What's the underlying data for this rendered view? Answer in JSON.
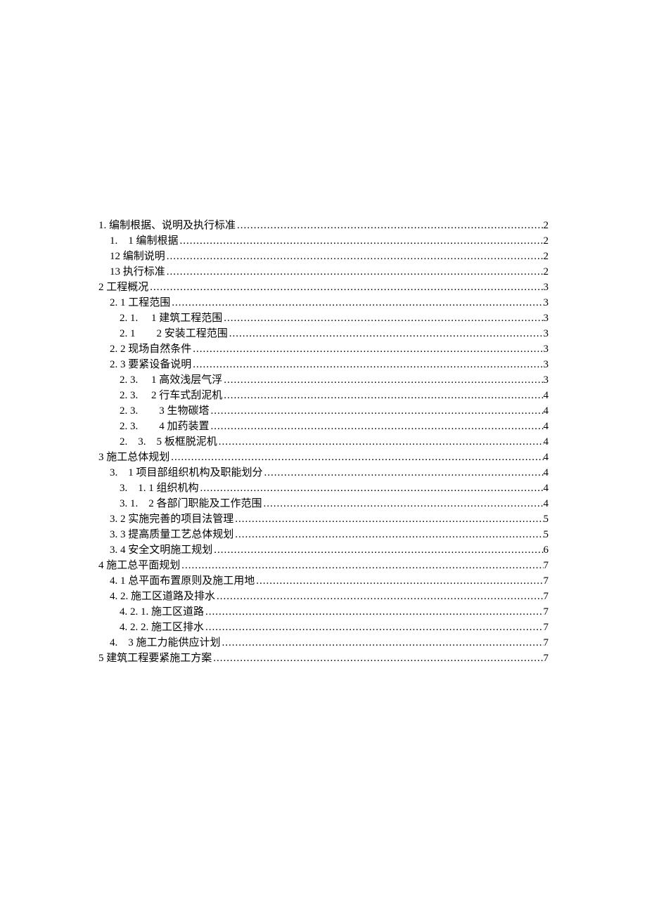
{
  "toc": [
    {
      "indent": 0,
      "label": "1. 编制根据、说明及执行标准",
      "page": "2"
    },
    {
      "indent": 1,
      "label": "1.　1 编制根据",
      "page": "2"
    },
    {
      "indent": 1,
      "label": "12 编制说明",
      "page": "2"
    },
    {
      "indent": 1,
      "label": "13 执行标准",
      "page": "2"
    },
    {
      "indent": 0,
      "label": "2 工程概况",
      "page": "3"
    },
    {
      "indent": 1,
      "label": "2. 1 工程范围",
      "page": "3"
    },
    {
      "indent": 2,
      "label": "2. 1.　 1 建筑工程范围",
      "page": "3"
    },
    {
      "indent": 2,
      "label": "2. 1　　2 安装工程范围",
      "page": "3"
    },
    {
      "indent": 1,
      "label": "2. 2 现场自然条件",
      "page": "3"
    },
    {
      "indent": 1,
      "label": "2. 3 要紧设备说明",
      "page": "3"
    },
    {
      "indent": 2,
      "label": "2. 3.　 1 高效浅层气浮",
      "page": "3"
    },
    {
      "indent": 2,
      "label": "2. 3.　 2 行车式刮泥机",
      "page": "4"
    },
    {
      "indent": 2,
      "label": "2. 3.　　3 生物碳塔",
      "page": "4"
    },
    {
      "indent": 2,
      "label": "2. 3.　　4 加药装置",
      "page": "4"
    },
    {
      "indent": 2,
      "label": "2.　3.　5 板框脱泥机",
      "page": "4"
    },
    {
      "indent": 0,
      "label": "3 施工总体规划",
      "page": "4"
    },
    {
      "indent": 1,
      "label": "3.　1 项目部组织机构及职能划分",
      "page": "4"
    },
    {
      "indent": 2,
      "label": "3.　1. 1 组织机构",
      "page": "4"
    },
    {
      "indent": 2,
      "label": "3. 1.　2 各部门职能及工作范围",
      "page": "4"
    },
    {
      "indent": 1,
      "label": "3. 2 实施完善的项目法管理",
      "page": "5"
    },
    {
      "indent": 1,
      "label": "3. 3 提高质量工艺总体规划",
      "page": "5"
    },
    {
      "indent": 1,
      "label": "3. 4 安全文明施工规划",
      "page": "6"
    },
    {
      "indent": 0,
      "label": "4 施工总平面规划",
      "page": "7"
    },
    {
      "indent": 1,
      "label": "4. 1 总平面布置原则及施工用地",
      "page": "7"
    },
    {
      "indent": 1,
      "label": "4. 2. 施工区道路及排水",
      "page": "7"
    },
    {
      "indent": 2,
      "label": "4. 2. 1. 施工区道路",
      "page": "7"
    },
    {
      "indent": 2,
      "label": "4. 2. 2. 施工区排水",
      "page": "7"
    },
    {
      "indent": 1,
      "label": "4.　3 施工力能供应计划",
      "page": "7"
    },
    {
      "indent": 0,
      "label": "5 建筑工程要紧施工方案",
      "page": "7"
    }
  ]
}
